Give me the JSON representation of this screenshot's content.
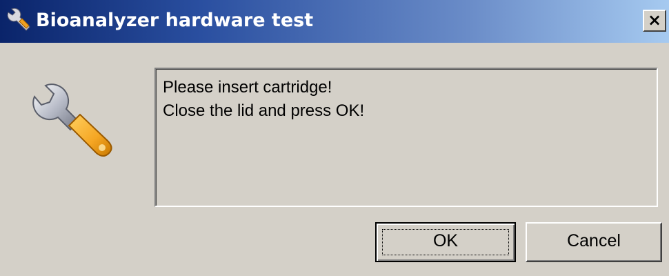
{
  "window": {
    "title": "Bioanalyzer hardware test",
    "close_label": "×"
  },
  "icons": {
    "title_icon": "wrench-icon",
    "dialog_icon": "wrench-icon"
  },
  "message": {
    "lines": [
      "Please insert cartridge!",
      "Close the lid and press OK!"
    ]
  },
  "buttons": {
    "ok_label": "OK",
    "cancel_label": "Cancel"
  },
  "colors": {
    "title_gradient_start": "#0a246a",
    "title_gradient_end": "#a6caf0",
    "dialog_face": "#d4d0c8",
    "wrench_handle": "#f0a020"
  }
}
